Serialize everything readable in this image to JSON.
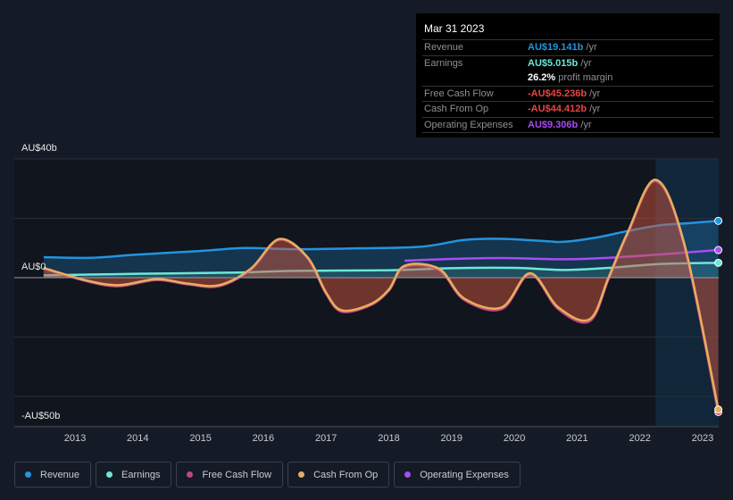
{
  "tooltip": {
    "date": "Mar 31 2023",
    "rows": [
      {
        "label": "Revenue",
        "value": "AU$19.141b",
        "unit": " /yr",
        "color": "#2394df"
      },
      {
        "label": "Earnings",
        "value": "AU$5.015b",
        "unit": " /yr",
        "color": "#6ee7d6"
      },
      {
        "label": "",
        "value": "26.2%",
        "unit": " profit margin",
        "color": "#ffffff"
      },
      {
        "label": "Free Cash Flow",
        "value": "-AU$45.236b",
        "unit": " /yr",
        "color": "#e84545"
      },
      {
        "label": "Cash From Op",
        "value": "-AU$44.412b",
        "unit": " /yr",
        "color": "#e84545"
      },
      {
        "label": "Operating Expenses",
        "value": "AU$9.306b",
        "unit": " /yr",
        "color": "#a64df0"
      }
    ]
  },
  "legend": [
    {
      "label": "Revenue",
      "color": "#2394df"
    },
    {
      "label": "Earnings",
      "color": "#6ee7d6"
    },
    {
      "label": "Free Cash Flow",
      "color": "#c4467f"
    },
    {
      "label": "Cash From Op",
      "color": "#e8ae5e"
    },
    {
      "label": "Operating Expenses",
      "color": "#a64df0"
    }
  ],
  "chart_data": {
    "type": "line",
    "y_tick_labels": [
      "AU$40b",
      "AU$0",
      "-AU$50b"
    ],
    "x_tick_labels": [
      "2013",
      "2014",
      "2015",
      "2016",
      "2017",
      "2018",
      "2019",
      "2020",
      "2021",
      "2022",
      "2023"
    ],
    "ylim": [
      -50,
      40
    ],
    "xlim": [
      2012.5,
      2023.25
    ],
    "highlight_start": 2022.25,
    "grid": true,
    "legend_placement": "bottom",
    "series": [
      {
        "name": "Revenue",
        "color": "#2394df",
        "x": [
          2012.5,
          2013.25,
          2014,
          2015,
          2015.7,
          2016.5,
          2017.5,
          2018.5,
          2019.2,
          2019.8,
          2020.5,
          2020.8,
          2021.3,
          2021.8,
          2022.3,
          2022.8,
          2023.25
        ],
        "values": [
          6.9,
          6.7,
          7.8,
          9.0,
          10.0,
          9.6,
          9.9,
          10.4,
          12.7,
          13.1,
          12.3,
          12.1,
          13.5,
          15.7,
          17.6,
          18.4,
          19.141
        ]
      },
      {
        "name": "Earnings",
        "color": "#6ee7d6",
        "x": [
          2012.5,
          2014,
          2015.5,
          2016.5,
          2018,
          2019,
          2020,
          2020.8,
          2021.5,
          2022.3,
          2023.25
        ],
        "values": [
          0.8,
          1.3,
          1.7,
          2.3,
          2.5,
          3.2,
          3.3,
          2.6,
          3.3,
          4.6,
          5.015
        ]
      },
      {
        "name": "Operating Expenses",
        "color": "#a64df0",
        "x": [
          2018.25,
          2019,
          2019.8,
          2020.8,
          2021.5,
          2022.3,
          2023.25
        ],
        "values": [
          5.7,
          6.3,
          6.6,
          6.2,
          6.7,
          7.8,
          9.306
        ]
      },
      {
        "name": "Free Cash Flow",
        "color": "#c4467f",
        "x": [
          2012.5,
          2013.2,
          2013.7,
          2014.3,
          2014.8,
          2015.3,
          2015.8,
          2016.25,
          2016.7,
          2017.0,
          2017.25,
          2017.7,
          2018.0,
          2018.25,
          2018.8,
          2019.2,
          2019.8,
          2020.25,
          2020.7,
          2021.2,
          2021.5,
          2021.8,
          2022.25,
          2022.7,
          2023.25
        ],
        "values": [
          3.1,
          -1.2,
          -2.8,
          -0.7,
          -2.2,
          -2.8,
          2.8,
          12.8,
          6.8,
          -5.3,
          -11.4,
          -9.3,
          -4.3,
          3.6,
          2.6,
          -7.4,
          -10.5,
          1.2,
          -10.5,
          -14.6,
          -0.4,
          14.6,
          32.6,
          11.6,
          -45.236
        ]
      },
      {
        "name": "Cash From Op",
        "color": "#e8ae5e",
        "x": [
          2012.5,
          2013.2,
          2013.7,
          2014.3,
          2014.8,
          2015.3,
          2015.8,
          2016.25,
          2016.7,
          2017.0,
          2017.25,
          2017.7,
          2018.0,
          2018.25,
          2018.8,
          2019.2,
          2019.8,
          2020.25,
          2020.7,
          2021.2,
          2021.5,
          2021.8,
          2022.25,
          2022.7,
          2023.25
        ],
        "values": [
          3.3,
          -1,
          -2.5,
          -0.5,
          -2,
          -2.5,
          3,
          13,
          7,
          -5,
          -11,
          -9,
          -4,
          4,
          3,
          -7,
          -10,
          1.5,
          -10,
          -14,
          0,
          15,
          33,
          12,
          -44.412
        ]
      }
    ]
  }
}
